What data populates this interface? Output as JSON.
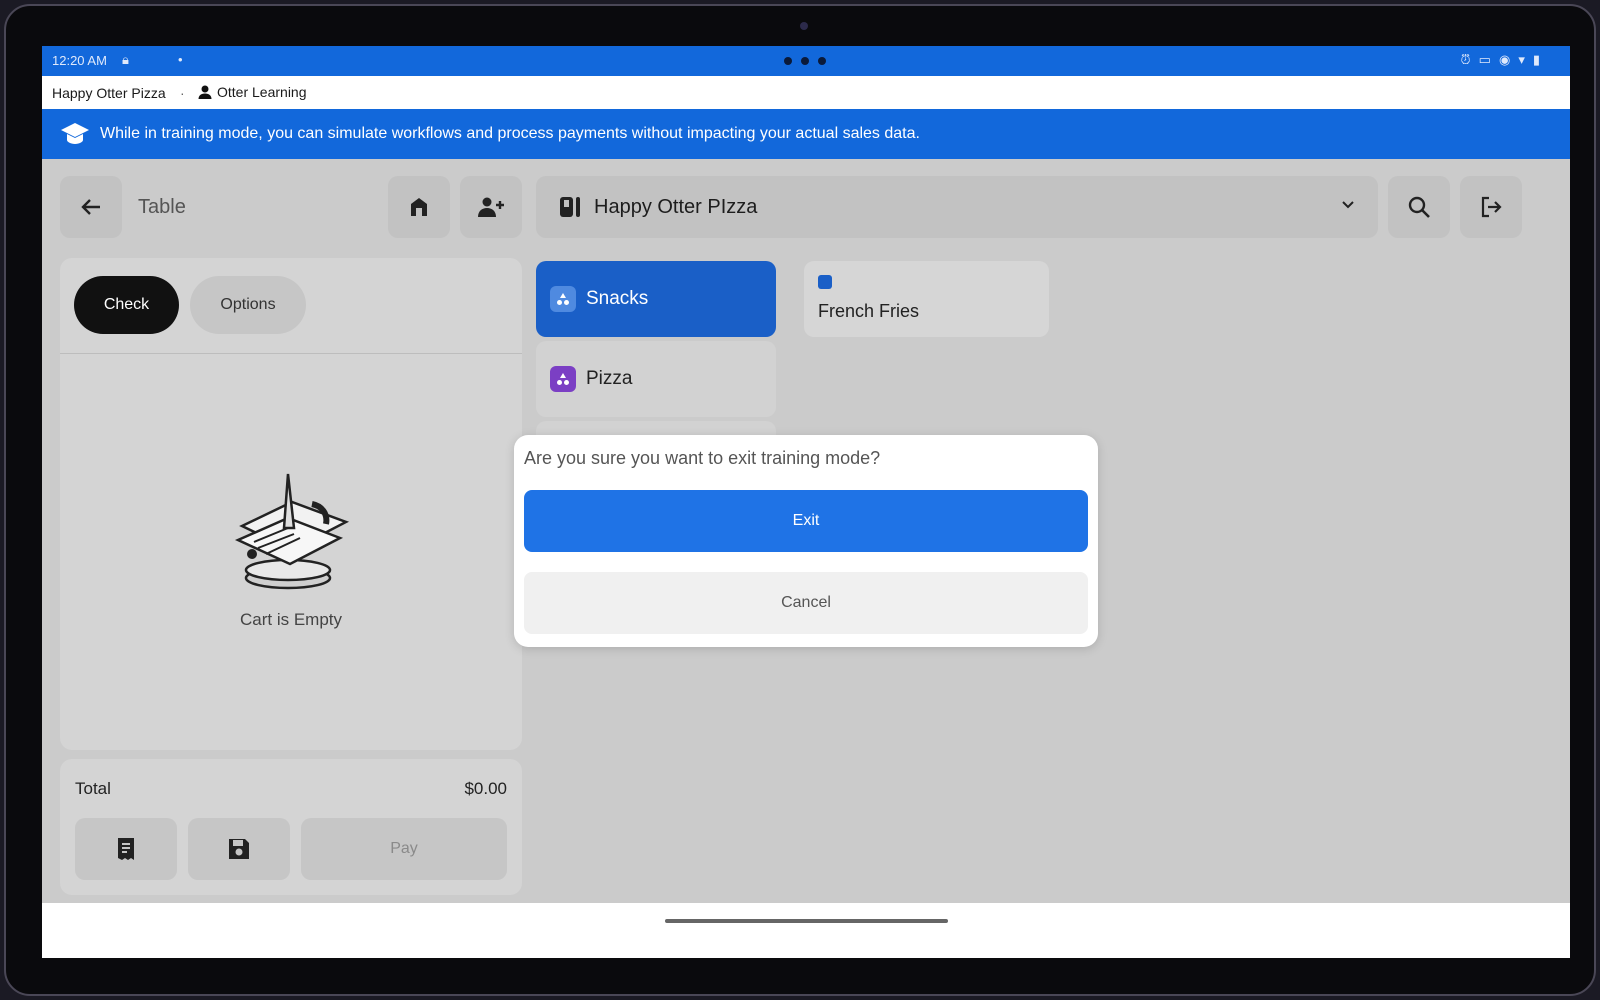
{
  "status_bar": {
    "time": "12:20 AM"
  },
  "info_bar": {
    "store_name": "Happy Otter Pizza",
    "separator": "·",
    "user_name": "Otter Learning"
  },
  "banner": {
    "text": "While in training mode, you can simulate workflows and process payments without impacting your actual sales data."
  },
  "order_header": {
    "table_label": "Table"
  },
  "store_select": {
    "name": "Happy Otter PIzza"
  },
  "cart": {
    "tabs": [
      "Check",
      "Options"
    ],
    "empty_text": "Cart is Empty",
    "total_label": "Total",
    "total_value": "$0.00",
    "pay_label": "Pay"
  },
  "menu": {
    "categories": [
      {
        "label": "Snacks",
        "color": "#1a5fc7",
        "selected": true
      },
      {
        "label": "Pizza",
        "color": "#7b3fc4",
        "selected": false
      }
    ],
    "items": [
      {
        "label": "French Fries",
        "color": "#1a5fc7"
      }
    ]
  },
  "dialog": {
    "message": "Are you sure you want to exit training mode?",
    "confirm_label": "Exit",
    "cancel_label": "Cancel"
  },
  "colors": {
    "accent": "#1268db",
    "primary_button": "#1f73e6"
  }
}
